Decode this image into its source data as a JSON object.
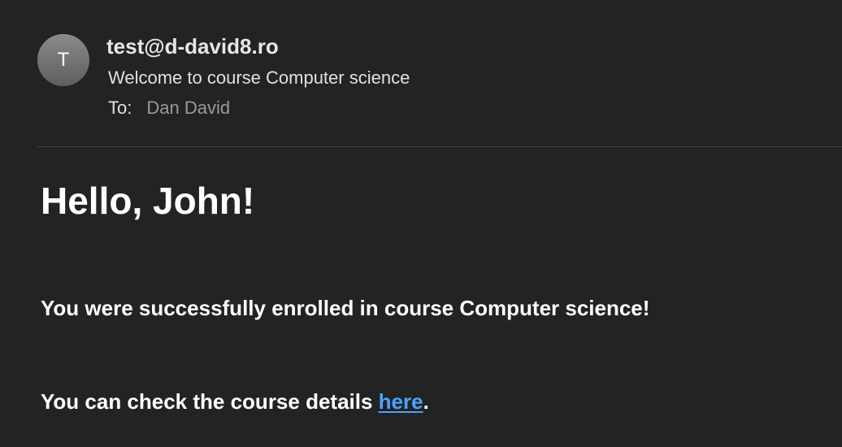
{
  "email": {
    "avatar_initial": "T",
    "sender": "test@d-david8.ro",
    "subject": "Welcome to course Computer science",
    "to_label": "To:",
    "to_name": "Dan David"
  },
  "body": {
    "greeting": "Hello, John!",
    "enrolled_text": "You were successfully enrolled in course Computer science!",
    "details_prefix": "You can check the course details ",
    "details_link_label": "here",
    "details_suffix": "."
  },
  "colors": {
    "background": "#232323",
    "link": "#4aa3ff",
    "muted_text": "#9a9a9a",
    "avatar": "#6f6f6f"
  },
  "icons": {
    "avatar": "sender-avatar"
  }
}
